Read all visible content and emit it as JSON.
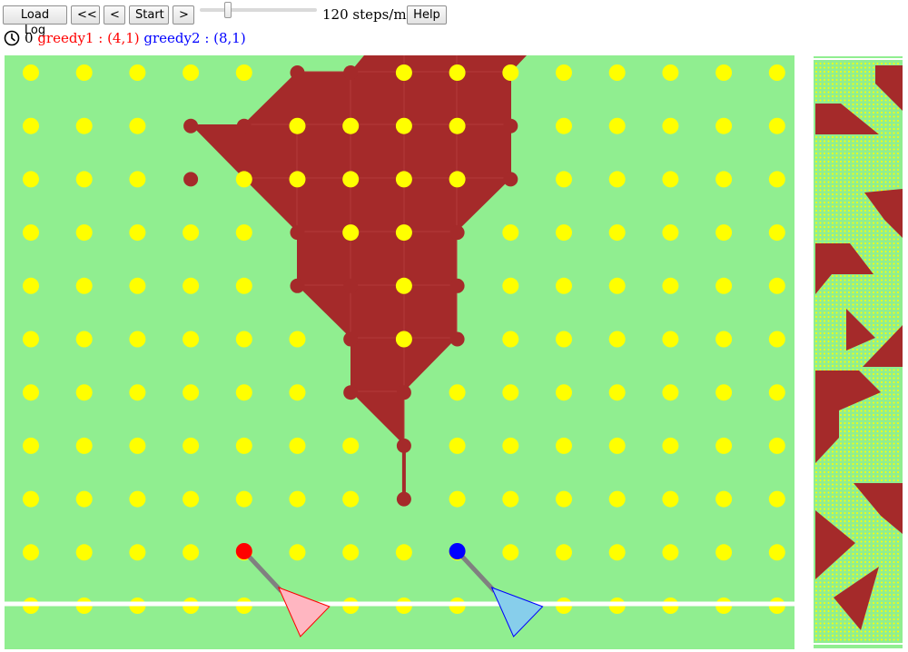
{
  "toolbar": {
    "load_log": "Load Log",
    "rewind": "<<",
    "step_back": "<",
    "start": "Start",
    "step_forward": ">",
    "speed_text": "120 steps/min",
    "help": "Help",
    "speed_value": 120
  },
  "status": {
    "clock_icon": "clock-icon",
    "step": "0",
    "player1": "greedy1 : (4,1)",
    "player2": "greedy2 : (8,1)"
  },
  "colors": {
    "field": "#90ee90",
    "dot": "#ffff00",
    "territory": "#a52a2a",
    "white_line": "#ffffff",
    "player1": "#ff0000",
    "player1_tank": "#ffb6c1",
    "player2": "#0000ff",
    "player2_tank": "#87ceeb",
    "link": "#808080"
  },
  "board": {
    "cols": 15,
    "rows": 11,
    "player1": {
      "cell": [
        4,
        1
      ]
    },
    "player2": {
      "cell": [
        8,
        1
      ]
    }
  }
}
